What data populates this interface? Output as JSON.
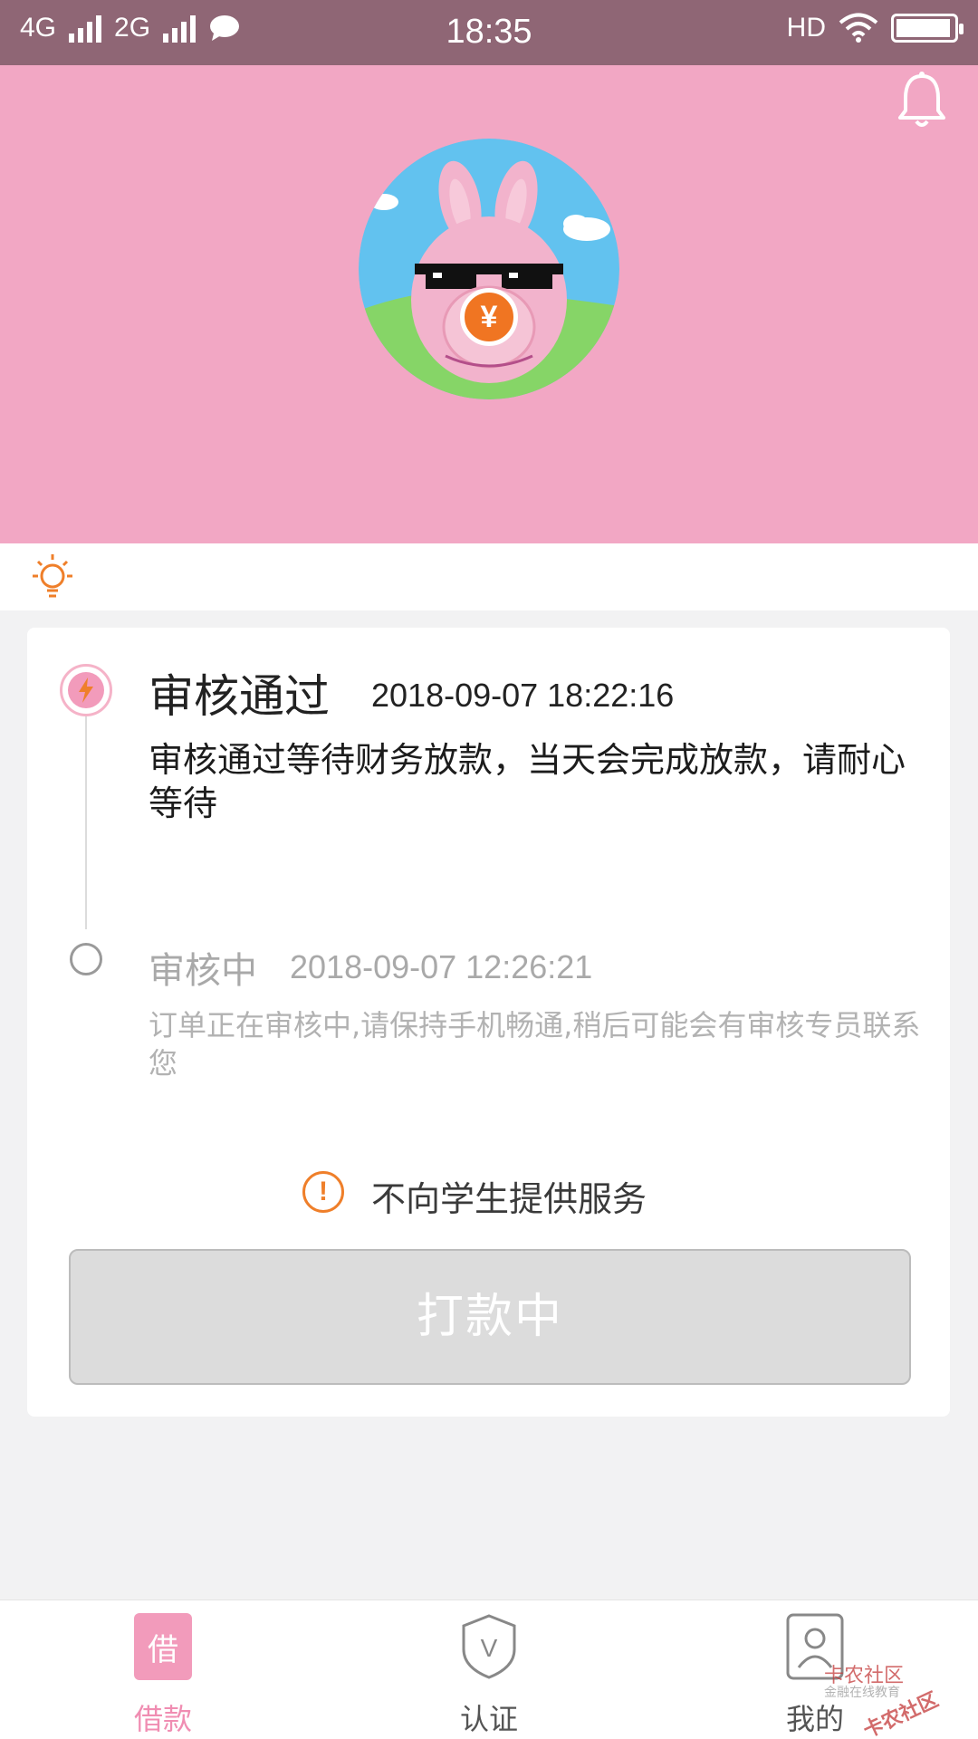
{
  "status_bar": {
    "network1": "4G",
    "network2": "2G",
    "time": "18:35",
    "hd": "HD",
    "battery_level": 0.95
  },
  "header": {
    "bell_icon": "bell-icon",
    "avatar_icon": "piggy-bank-avatar",
    "coin_symbol": "¥"
  },
  "tip": {
    "icon": "lightbulb-icon"
  },
  "timeline": [
    {
      "title": "审核通过",
      "time": "2018-09-07 18:22:16",
      "description": "审核通过等待财务放款，当天会完成放款，请耐心等待"
    },
    {
      "title": "审核中",
      "time": "2018-09-07 12:26:21",
      "description": "订单正在审核中,请保持手机畅通,稍后可能会有审核专员联系您"
    }
  ],
  "notice": {
    "icon_text": "!",
    "text": "不向学生提供服务"
  },
  "action_button": {
    "label": "打款中"
  },
  "bottom_nav": {
    "items": [
      {
        "label": "借款",
        "icon_text": "借",
        "icon": "loan-icon",
        "active": true
      },
      {
        "label": "认证",
        "icon_text": "V",
        "icon": "shield-icon",
        "active": false
      },
      {
        "label": "我的",
        "icon": "profile-icon",
        "active": false
      }
    ]
  },
  "watermark": {
    "line1": "卡农社区",
    "line2": "金融在线教育",
    "line3": "卡农社区"
  },
  "colors": {
    "status_bar": "#8f6675",
    "hero": "#f2a7c4",
    "accent_pink": "#f29bbb",
    "warning_orange": "#ef7f2a"
  }
}
